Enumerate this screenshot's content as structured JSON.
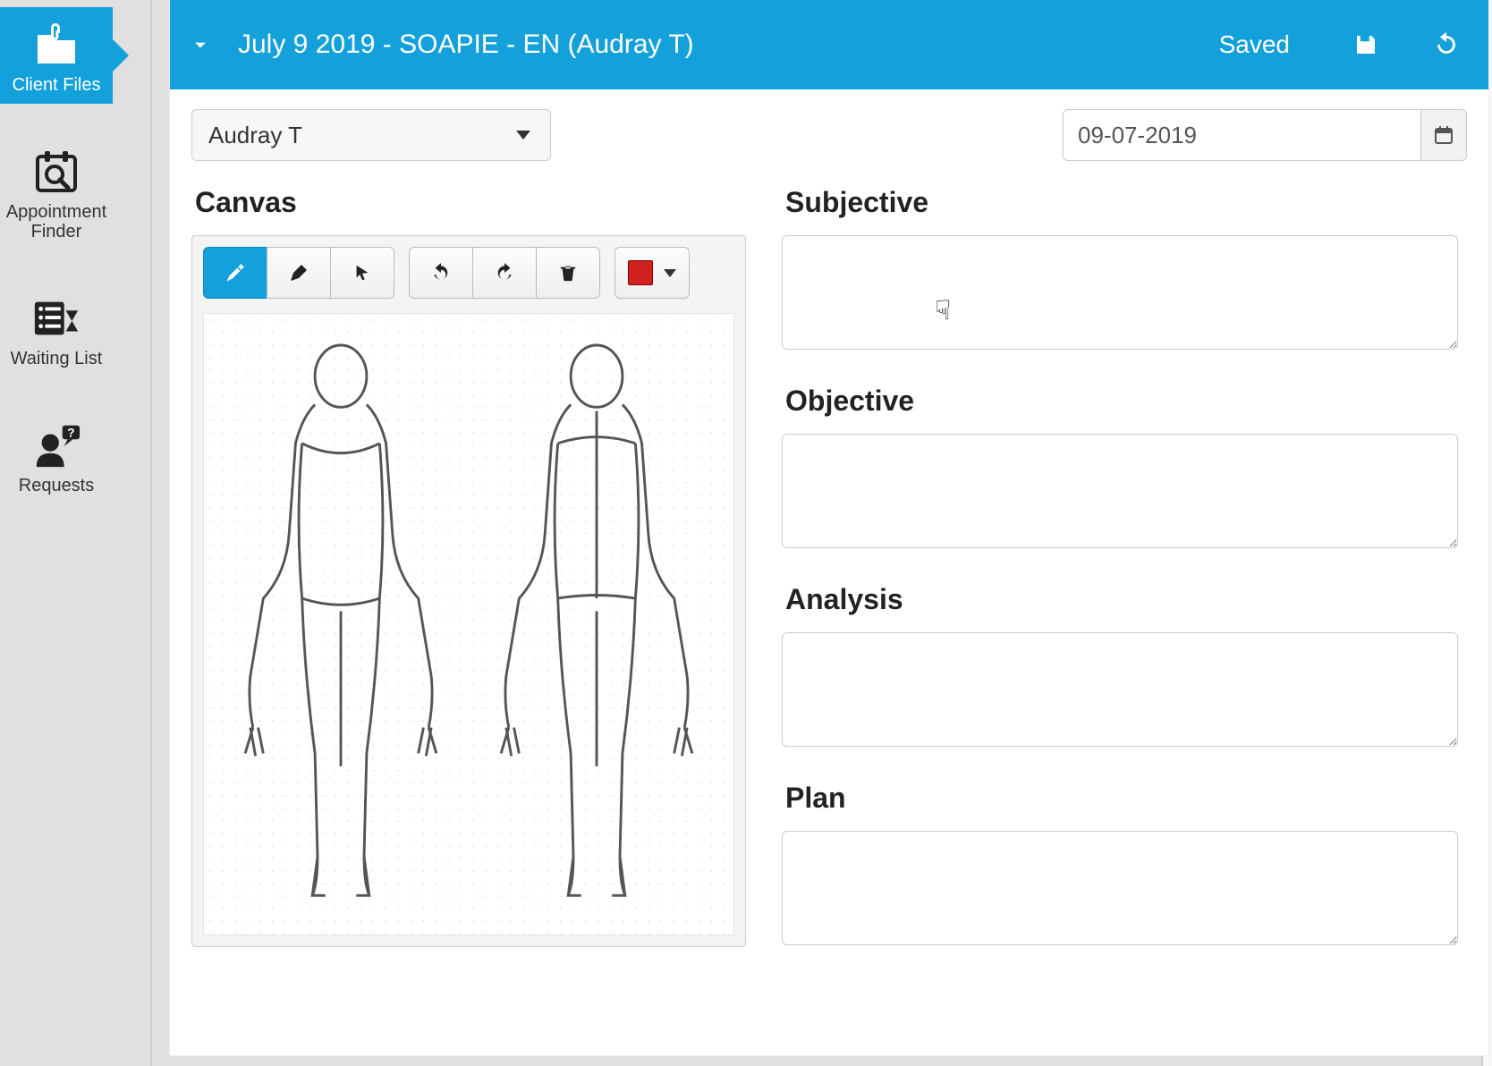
{
  "sidebar": {
    "items": [
      {
        "label": "Client Files",
        "icon": "clip-folder"
      },
      {
        "label": "Appointment\nFinder",
        "icon": "calendar-search"
      },
      {
        "label": "Waiting List",
        "icon": "list-hourglass"
      },
      {
        "label": "Requests",
        "icon": "person-question"
      }
    ]
  },
  "header": {
    "title": "July 9 2019 - SOAPIE - EN (Audray T)",
    "status": "Saved"
  },
  "patient": {
    "selected": "Audray T"
  },
  "date": {
    "value": "09-07-2019"
  },
  "canvas": {
    "title": "Canvas",
    "color": "#d21f1f"
  },
  "notes": {
    "sections": [
      {
        "title": "Subjective",
        "value": ""
      },
      {
        "title": "Objective",
        "value": ""
      },
      {
        "title": "Analysis",
        "value": ""
      },
      {
        "title": "Plan",
        "value": ""
      }
    ]
  }
}
